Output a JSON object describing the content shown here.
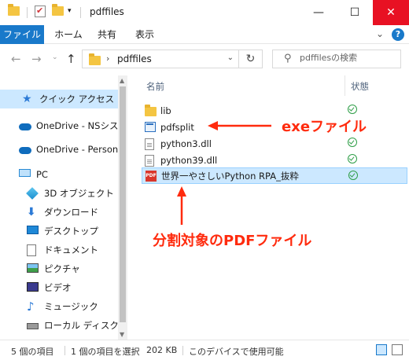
{
  "window": {
    "title": "pdffiles",
    "minimize": "—",
    "maximize": "☐",
    "close": "✕"
  },
  "ribbon": {
    "tabs": [
      "ファイル",
      "ホーム",
      "共有",
      "表示"
    ],
    "expand_glyph": "⌄",
    "help_glyph": "?"
  },
  "address": {
    "path": "pdffiles",
    "search_placeholder": "pdffilesの検索"
  },
  "nav": {
    "items": [
      {
        "label": "クイック アクセス",
        "icon": "star-icon"
      },
      {
        "label": "OneDrive - NSシステム",
        "icon": "cloud-icon"
      },
      {
        "label": "OneDrive - Personal",
        "icon": "cloud-icon"
      },
      {
        "label": "PC",
        "icon": "pc-icon"
      },
      {
        "label": "3D オブジェクト",
        "icon": "cube-icon"
      },
      {
        "label": "ダウンロード",
        "icon": "download-icon"
      },
      {
        "label": "デスクトップ",
        "icon": "desktop-icon"
      },
      {
        "label": "ドキュメント",
        "icon": "document-icon"
      },
      {
        "label": "ピクチャ",
        "icon": "picture-icon"
      },
      {
        "label": "ビデオ",
        "icon": "video-icon"
      },
      {
        "label": "ミュージック",
        "icon": "music-icon"
      },
      {
        "label": "ローカル ディスク (C:)",
        "icon": "disk-icon"
      }
    ]
  },
  "list": {
    "col_name": "名前",
    "col_state": "状態",
    "files": [
      {
        "name": "lib",
        "icon": "folder-icon"
      },
      {
        "name": "pdfsplit",
        "icon": "exe-icon"
      },
      {
        "name": "python3.dll",
        "icon": "file-icon"
      },
      {
        "name": "python39.dll",
        "icon": "file-icon"
      },
      {
        "name": "世界一やさしいPython RPA_抜粋",
        "icon": "pdf-icon"
      }
    ]
  },
  "annotations": {
    "exe": "exeファイル",
    "pdf": "分割対象のPDFファイル"
  },
  "status": {
    "count": "5 個の項目",
    "selected": "1 個の項目を選択",
    "size": "202 KB",
    "availability": "このデバイスで使用可能"
  },
  "colors": {
    "accent": "#1979ca",
    "selection": "#cce8ff",
    "annotation": "#ff2b0e",
    "ok_green": "#2e9e47"
  }
}
